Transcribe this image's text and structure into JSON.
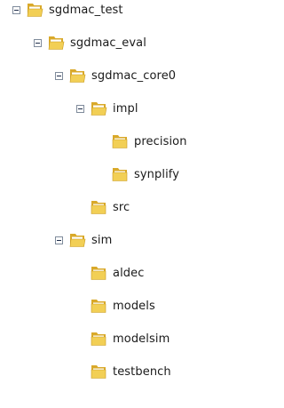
{
  "tree": {
    "nodes": [
      {
        "label": "sgdmac_test",
        "depth": 0,
        "expanded": true,
        "toggle": true,
        "icon": "folder-open-icon"
      },
      {
        "label": "sgdmac_eval",
        "depth": 1,
        "expanded": true,
        "toggle": true,
        "icon": "folder-open-icon"
      },
      {
        "label": "sgdmac_core0",
        "depth": 2,
        "expanded": true,
        "toggle": true,
        "icon": "folder-open-icon"
      },
      {
        "label": "impl",
        "depth": 3,
        "expanded": true,
        "toggle": true,
        "icon": "folder-open-icon"
      },
      {
        "label": "precision",
        "depth": 4,
        "expanded": false,
        "toggle": false,
        "icon": "folder-icon"
      },
      {
        "label": "synplify",
        "depth": 4,
        "expanded": false,
        "toggle": false,
        "icon": "folder-icon"
      },
      {
        "label": "src",
        "depth": 3,
        "expanded": false,
        "toggle": false,
        "icon": "folder-icon"
      },
      {
        "label": "sim",
        "depth": 2,
        "expanded": true,
        "toggle": true,
        "icon": "folder-open-icon"
      },
      {
        "label": "aldec",
        "depth": 3,
        "expanded": false,
        "toggle": false,
        "icon": "folder-icon"
      },
      {
        "label": "models",
        "depth": 3,
        "expanded": false,
        "toggle": false,
        "icon": "folder-icon"
      },
      {
        "label": "modelsim",
        "depth": 3,
        "expanded": false,
        "toggle": false,
        "icon": "folder-icon"
      },
      {
        "label": "testbench",
        "depth": 3,
        "expanded": false,
        "toggle": false,
        "icon": "folder-icon"
      }
    ]
  },
  "colors": {
    "folder_front": "#f2cf55",
    "folder_back": "#d9a92a",
    "folder_paper": "#ffffff"
  }
}
